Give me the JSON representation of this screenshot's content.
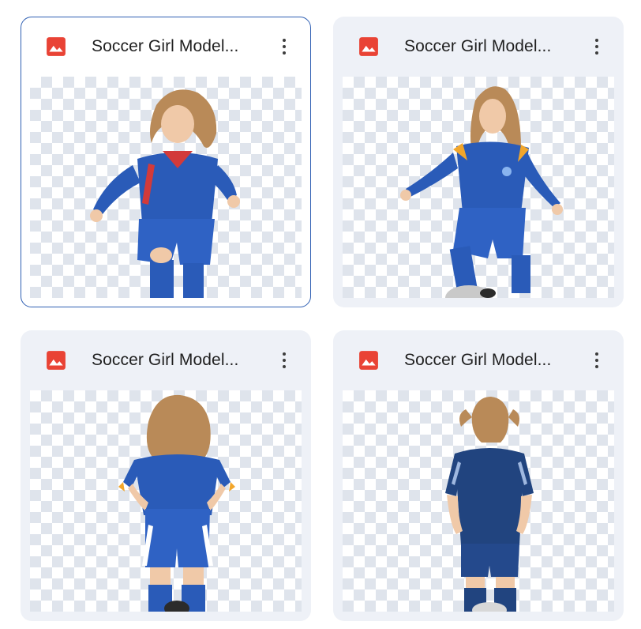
{
  "files": [
    {
      "title": "Soccer Girl Model...",
      "icon": "image-file-icon",
      "menu_icon": "more-vert-icon",
      "selected": true
    },
    {
      "title": "Soccer Girl Model...",
      "icon": "image-file-icon",
      "menu_icon": "more-vert-icon",
      "selected": false
    },
    {
      "title": "Soccer Girl Model...",
      "icon": "image-file-icon",
      "menu_icon": "more-vert-icon",
      "selected": false
    },
    {
      "title": "Soccer Girl Model...",
      "icon": "image-file-icon",
      "menu_icon": "more-vert-icon",
      "selected": false
    }
  ],
  "colors": {
    "accent_border": "#2f5fb3",
    "image_icon": "#e94335",
    "card_bg": "#eef1f7",
    "jersey_blue": "#2a5bb8"
  }
}
